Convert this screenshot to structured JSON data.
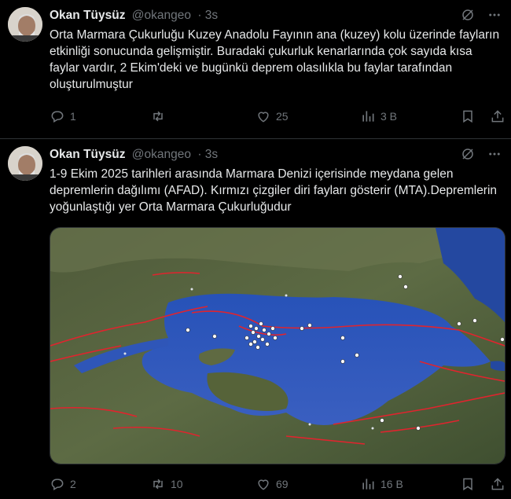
{
  "tweets": [
    {
      "author_name": "Okan Tüysüz",
      "handle": "@okangeo",
      "time": "· 3s",
      "text": "Orta Marmara Çukurluğu Kuzey Anadolu Fayının ana (kuzey) kolu üzerinde fayların etkinliği sonucunda gelişmiştir. Buradaki çukurluk kenarlarında çok sayıda kısa faylar vardır, 2 Ekim'deki ve bugünkü deprem olasılıkla bu faylar tarafından oluşturulmuştur",
      "replies": "1",
      "retweets": "",
      "likes": "25",
      "views": "3 B"
    },
    {
      "author_name": "Okan Tüysüz",
      "handle": "@okangeo",
      "time": "· 3s",
      "text": "1-9 Ekim 2025 tarihleri arasında Marmara Denizi içerisinde meydana gelen depremlerin dağılımı (AFAD). Kırmızı çizgiler diri fayları gösterir (MTA).Depremlerin yoğunlaştığı yer Orta Marmara Çukurluğudur",
      "replies": "2",
      "retweets": "10",
      "likes": "69",
      "views": "16 B"
    }
  ],
  "icons": {
    "grok": "slash-circle-icon",
    "more": "more-dots-icon",
    "reply": "reply-icon",
    "retweet": "retweet-icon",
    "like": "heart-icon",
    "views": "views-bar-icon",
    "bookmark": "bookmark-icon",
    "share": "share-icon"
  },
  "colors": {
    "background": "#000000",
    "text": "#e7e9ea",
    "muted": "#71767b",
    "divider": "#2f3336",
    "sea": "#2f56b8",
    "fault": "#e0242e"
  }
}
